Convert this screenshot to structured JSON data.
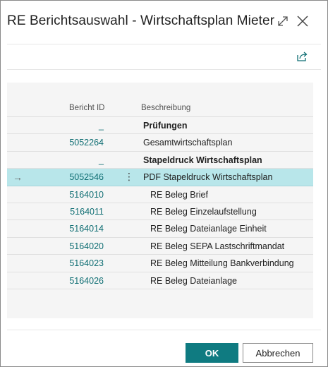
{
  "dialog": {
    "title": "RE Berichtsauswahl - Wirtschaftsplan Mieter",
    "expand_icon": "expand-icon",
    "close_icon": "close-icon",
    "share_icon": "share-icon"
  },
  "table": {
    "columns": [
      "Bericht ID",
      "Beschreibung"
    ],
    "rows": [
      {
        "id": "_",
        "desc": "Prüfungen",
        "bold": true,
        "indent": 0
      },
      {
        "id": "5052264",
        "desc": "Gesamtwirtschaftsplan",
        "bold": false,
        "indent": 0
      },
      {
        "id": "_",
        "desc": "Stapeldruck Wirtschaftsplan",
        "bold": true,
        "indent": 0
      },
      {
        "id": "5052546",
        "desc": "PDF Stapeldruck Wirtschaftsplan",
        "bold": false,
        "indent": 0,
        "selected": true,
        "arrow": "→",
        "menu": "⋮"
      },
      {
        "id": "5164010",
        "desc": "RE Beleg Brief",
        "bold": false,
        "indent": 1
      },
      {
        "id": "5164011",
        "desc": "RE Beleg Einzelaufstellung",
        "bold": false,
        "indent": 1
      },
      {
        "id": "5164014",
        "desc": "RE Beleg Dateianlage Einheit",
        "bold": false,
        "indent": 1
      },
      {
        "id": "5164020",
        "desc": "RE Beleg SEPA Lastschriftmandat",
        "bold": false,
        "indent": 1
      },
      {
        "id": "5164023",
        "desc": "RE Beleg Mitteilung Bankverbindung",
        "bold": false,
        "indent": 1
      },
      {
        "id": "5164026",
        "desc": "RE Beleg Dateianlage",
        "bold": false,
        "indent": 1
      }
    ]
  },
  "buttons": {
    "ok": "OK",
    "cancel": "Abbrechen"
  },
  "colors": {
    "accent": "#0f7b81",
    "link": "#0f6e73",
    "selected_row": "#b8e6ea"
  }
}
